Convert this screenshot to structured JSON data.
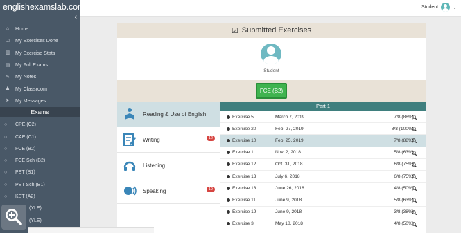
{
  "app": {
    "brand": "englishexamslab.com"
  },
  "user": {
    "name": "Student"
  },
  "sidebar": {
    "nav": [
      {
        "label": "Home",
        "icon": "home-icon",
        "glyph": "⌂"
      },
      {
        "label": "My Exercises Done",
        "icon": "checkbox-icon",
        "glyph": "☑"
      },
      {
        "label": "My Exercise Stats",
        "icon": "bar-chart-icon",
        "glyph": "▥"
      },
      {
        "label": "My Full Exams",
        "icon": "file-icon",
        "glyph": "▤"
      },
      {
        "label": "My Notes",
        "icon": "edit-icon",
        "glyph": "✎"
      },
      {
        "label": "My Classroom",
        "icon": "users-icon",
        "glyph": "♟"
      },
      {
        "label": "My Messages",
        "icon": "send-icon",
        "glyph": "➤"
      }
    ],
    "exams_heading": "Exams",
    "exams": [
      {
        "label": "CPE (C2)"
      },
      {
        "label": "CAE (C1)"
      },
      {
        "label": "FCE (B2)"
      },
      {
        "label": "FCE Sch (B2)"
      },
      {
        "label": "PET (B1)"
      },
      {
        "label": "PET Sch (B1)"
      },
      {
        "label": "KET (A2)"
      },
      {
        "label": "(YLE)"
      },
      {
        "label": "(YLE)"
      }
    ]
  },
  "panel": {
    "title": "Submitted Exercises",
    "role": "Student",
    "level_button": "FCE (B2)"
  },
  "sections": [
    {
      "label": "Reading & Use of English",
      "badge": ""
    },
    {
      "label": "Writing",
      "badge": "12"
    },
    {
      "label": "Listening",
      "badge": ""
    },
    {
      "label": "Speaking",
      "badge": "19"
    }
  ],
  "table": {
    "part_title": "Part 1",
    "rows": [
      {
        "exercise": "Exercise 5",
        "date": "March 7, 2019",
        "score": "7/8 (88%)"
      },
      {
        "exercise": "Exercise 20",
        "date": "Feb. 27, 2019",
        "score": "8/8 (100%)"
      },
      {
        "exercise": "Exercise 10",
        "date": "Feb. 25, 2019",
        "score": "7/8 (88%)"
      },
      {
        "exercise": "Exercise 1",
        "date": "Nov. 2, 2018",
        "score": "5/8 (63%)"
      },
      {
        "exercise": "Exercise 12",
        "date": "Oct. 31, 2018",
        "score": "6/8 (75%)"
      },
      {
        "exercise": "Exercise 13",
        "date": "July 6, 2018",
        "score": "6/8 (75%)"
      },
      {
        "exercise": "Exercise 13",
        "date": "June 26, 2018",
        "score": "4/8 (50%)"
      },
      {
        "exercise": "Exercise 11",
        "date": "June 9, 2018",
        "score": "5/8 (63%)"
      },
      {
        "exercise": "Exercise 19",
        "date": "June 9, 2018",
        "score": "3/8 (38%)"
      },
      {
        "exercise": "Exercise 3",
        "date": "May 18, 2018",
        "score": "4/8 (50%)"
      }
    ]
  },
  "colors": {
    "sidebar": "#495867",
    "accent_teal": "#3f7f7e",
    "highlight": "#cfdfe3",
    "level_green": "#3fb34f",
    "badge_red": "#d64541",
    "beige": "#e9e2d7"
  }
}
